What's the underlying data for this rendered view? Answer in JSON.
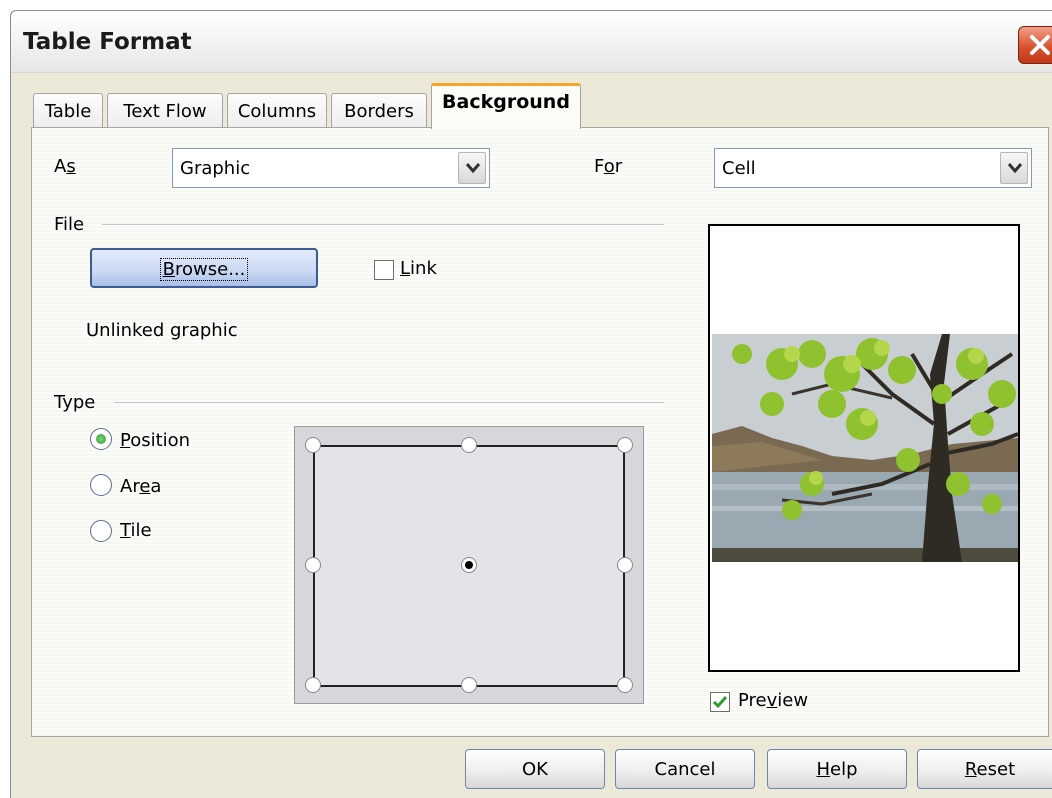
{
  "window": {
    "title": "Table Format"
  },
  "tabs": [
    {
      "label": "Table"
    },
    {
      "label": "Text Flow"
    },
    {
      "label": "Columns"
    },
    {
      "label": "Borders"
    },
    {
      "label": "Background"
    }
  ],
  "as": {
    "label_pre": "A",
    "label_key": "s",
    "value": "Graphic"
  },
  "for": {
    "label_pre": "F",
    "label_key": "o",
    "label_post": "r",
    "value": "Cell"
  },
  "file": {
    "section_label": "File",
    "browse_key": "B",
    "browse_rest": "rowse...",
    "link_key": "L",
    "link_rest": "ink",
    "link_checked": false,
    "status": "Unlinked graphic"
  },
  "type": {
    "section_label": "Type",
    "options": [
      {
        "key": "P",
        "rest": "osition",
        "selected": true
      },
      {
        "pre": "Ar",
        "key": "e",
        "rest": "a",
        "selected": false
      },
      {
        "key": "T",
        "rest": "ile",
        "selected": false
      }
    ]
  },
  "preview": {
    "pre": "Pre",
    "key": "v",
    "rest": "iew",
    "checked": true
  },
  "buttons": {
    "ok": "OK",
    "cancel": "Cancel",
    "help_key": "H",
    "help_rest": "elp",
    "reset_key": "R",
    "reset_rest": "eset"
  },
  "colors": {
    "accent_tab": "#f5a623",
    "checkmark": "#2e9b2e",
    "close": "#d9532f"
  }
}
